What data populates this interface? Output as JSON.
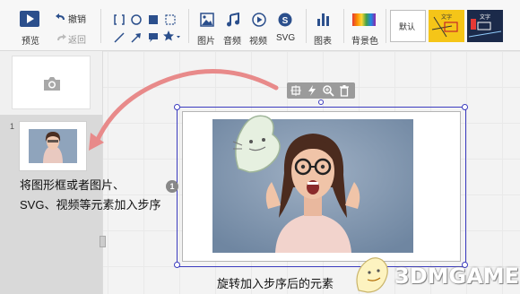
{
  "toolbar": {
    "preview_label": "预览",
    "undo_label": "撤销",
    "redo_label": "返回",
    "image_label": "图片",
    "audio_label": "音频",
    "video_label": "视频",
    "svg_label": "SVG",
    "chart_label": "图表",
    "bgcolor_label": "背景色",
    "default_label": "默认",
    "thumb_text": "文字"
  },
  "left_panel": {
    "step_number": "1"
  },
  "annotation": {
    "line1": "将图形框或者图片、",
    "line2": "SVG、视频等元素加入步序"
  },
  "canvas": {
    "badge_number": "1",
    "bottom_caption": "旋转加入步序后的元素"
  },
  "watermark": {
    "text": "3DMGAME"
  },
  "colors": {
    "selection": "#3b3bbf",
    "arrow": "#e88a8a"
  }
}
